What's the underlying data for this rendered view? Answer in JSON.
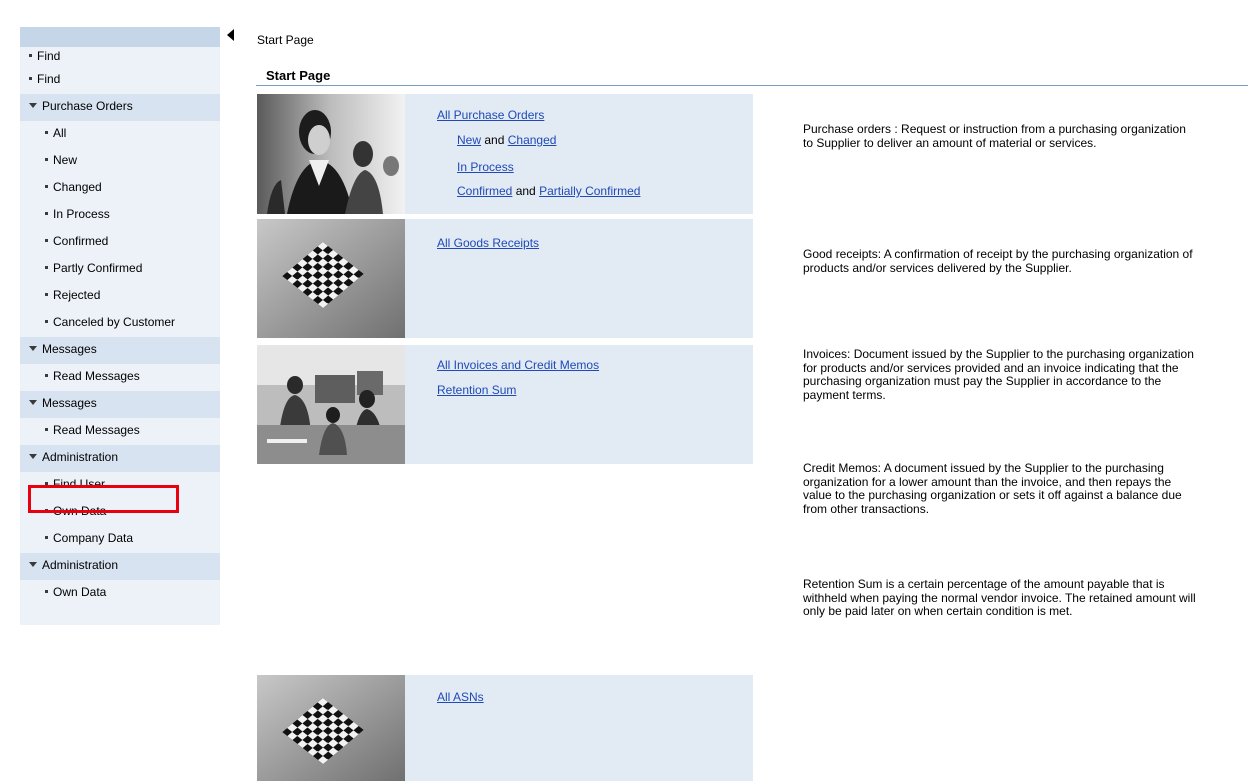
{
  "sidebar": {
    "items": [
      {
        "type": "top",
        "label": "Find"
      },
      {
        "type": "top",
        "label": "Find"
      },
      {
        "type": "cat",
        "label": "Purchase Orders"
      },
      {
        "type": "sub",
        "label": "All"
      },
      {
        "type": "sub",
        "label": "New"
      },
      {
        "type": "sub",
        "label": "Changed"
      },
      {
        "type": "sub",
        "label": "In Process"
      },
      {
        "type": "sub",
        "label": "Confirmed"
      },
      {
        "type": "sub",
        "label": "Partly Confirmed"
      },
      {
        "type": "sub",
        "label": "Rejected"
      },
      {
        "type": "sub",
        "label": "Canceled by Customer"
      },
      {
        "type": "cat",
        "label": "Messages"
      },
      {
        "type": "sub",
        "label": "Read Messages"
      },
      {
        "type": "cat",
        "label": "Messages"
      },
      {
        "type": "sub",
        "label": "Read Messages"
      },
      {
        "type": "cat",
        "label": "Administration"
      },
      {
        "type": "sub",
        "label": "Find User"
      },
      {
        "type": "sub",
        "label": "Own Data"
      },
      {
        "type": "sub",
        "label": "Company Data"
      },
      {
        "type": "cat",
        "label": "Administration"
      },
      {
        "type": "sub",
        "label": "Own Data"
      }
    ]
  },
  "breadcrumb": "Start Page",
  "page_title": "Start Page",
  "tiles": {
    "purchase_orders": {
      "all": "All Purchase Orders",
      "new": "New",
      "and1": "and",
      "changed": "Changed",
      "in_process": "In Process",
      "confirmed": "Confirmed",
      "and2": "and",
      "partially_confirmed": "Partially Confirmed"
    },
    "goods_receipts": {
      "all": "All Goods Receipts"
    },
    "invoices": {
      "all": "All Invoices and Credit Memos",
      "retention": "Retention Sum"
    },
    "asns": {
      "all": "All ASNs"
    }
  },
  "descriptions": {
    "purchase_orders": "Purchase orders : Request or instruction from a purchasing organization to Supplier to deliver an amount of material or services.",
    "goods_receipts": "Good receipts: A confirmation of receipt by the purchasing organization of products and/or services delivered by the Supplier.",
    "invoices": "Invoices: Document issued by the Supplier to the purchasing organization for products and/or services provided and an invoice indicating that the purchasing organization must pay the Supplier in accordance to the payment terms.",
    "credit_memos": "Credit Memos: A document issued by the Supplier to the purchasing organization for a lower amount than the invoice, and then repays the value to the purchasing organization or sets it off against a balance due from other transactions.",
    "retention": "Retention Sum is a certain percentage of the amount payable that is withheld when paying the normal vendor invoice. The retained amount will only be paid later on when certain condition is met."
  },
  "colors": {
    "link": "#1f4ab7",
    "tile_bg": "#e2eaf4",
    "sidebar_category_bg": "#d7e3f0",
    "highlight": "#e8000f"
  }
}
